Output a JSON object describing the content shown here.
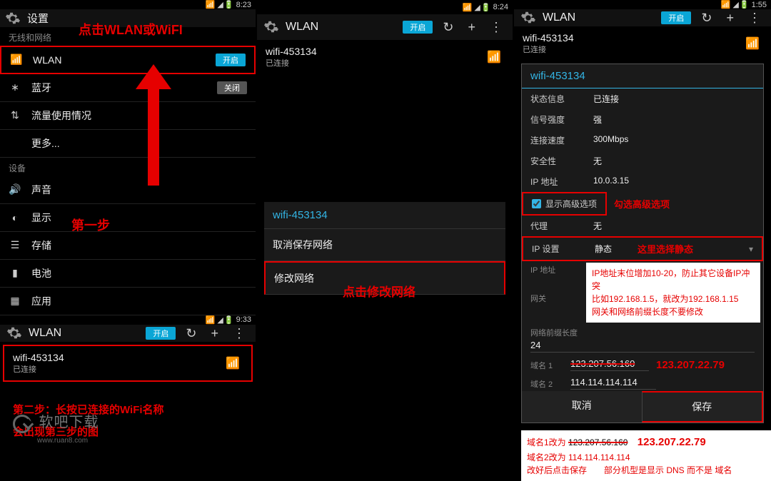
{
  "status": {
    "time1": "8:23",
    "time2": "8:24",
    "time2b": "9:33",
    "time3": "1:55",
    "sig": "◢",
    "wifi": "📶",
    "batt": "▮"
  },
  "panel1": {
    "title": "设置",
    "annot_top": "点击WLAN或WiFI",
    "sec_wireless": "无线和网络",
    "item_wlan": "WLAN",
    "wlan_state": "开启",
    "item_bt": "蓝牙",
    "bt_state": "关闭",
    "item_data": "流量使用情况",
    "item_more": "更多...",
    "sec_device": "设备",
    "item_sound": "声音",
    "item_display": "显示",
    "item_storage": "存储",
    "item_battery": "电池",
    "item_app": "应用",
    "annot_step1": "第一步",
    "wlan_title": "WLAN",
    "wlan_state2": "开启",
    "wifi_name": "wifi-453134",
    "wifi_status": "已连接",
    "annot_step2_l1": "第二步：长按已连接的WiFi名称",
    "annot_step2_l2": "会出现第三步的图"
  },
  "panel2": {
    "title": "WLAN",
    "state": "开启",
    "wifi_name": "wifi-453134",
    "wifi_status": "已连接",
    "dhead": "wifi-453134",
    "d1": "取消保存网络",
    "d2": "修改网络",
    "annot": "点击修改网络"
  },
  "panel3": {
    "title": "WLAN",
    "state": "开启",
    "wifi_name": "wifi-453134",
    "wifi_status": "已连接",
    "dhead": "wifi-453134",
    "kv": {
      "status_k": "状态信息",
      "status_v": "已连接",
      "sig_k": "信号强度",
      "sig_v": "强",
      "speed_k": "连接速度",
      "speed_v": "300Mbps",
      "sec_k": "安全性",
      "sec_v": "无",
      "ip_k": "IP 地址",
      "ip_v": "10.0.3.15"
    },
    "adv_label": "显示高级选项",
    "annot_adv": "勾选高级选项",
    "proxy_k": "代理",
    "proxy_v": "无",
    "ipset_k": "IP 设置",
    "ipset_v": "静态",
    "annot_ipset": "这里选择静态",
    "hint1": "IP地址末位增加10-20，防止其它设备IP冲突",
    "hint2": "比如192.168.1.5，就改为192.168.1.15",
    "hint3": "网关和网络前缀长度不要修改",
    "f_ip": "IP 地址",
    "f_gw": "网关",
    "f_prefix": "网络前缀长度",
    "f_prefix_v": "24",
    "f_dns1": "域名 1",
    "f_dns1_v": "123.207.56.160",
    "f_dns1_new": "123.207.22.79",
    "f_dns2": "域名 2",
    "f_dns2_v": "114.114.114.114",
    "btn_cancel": "取消",
    "btn_save": "保存",
    "note1a": "域名1改为 ",
    "note1b": "123.207.56.160",
    "note1c": "123.207.22.79",
    "note2": "域名2改为 114.114.114.114",
    "note3": "改好后点击保存　　部分机型是显示 DNS 而不是 域名"
  },
  "logo": {
    "name": "软吧下载",
    "url": "www.ruan8.com"
  }
}
